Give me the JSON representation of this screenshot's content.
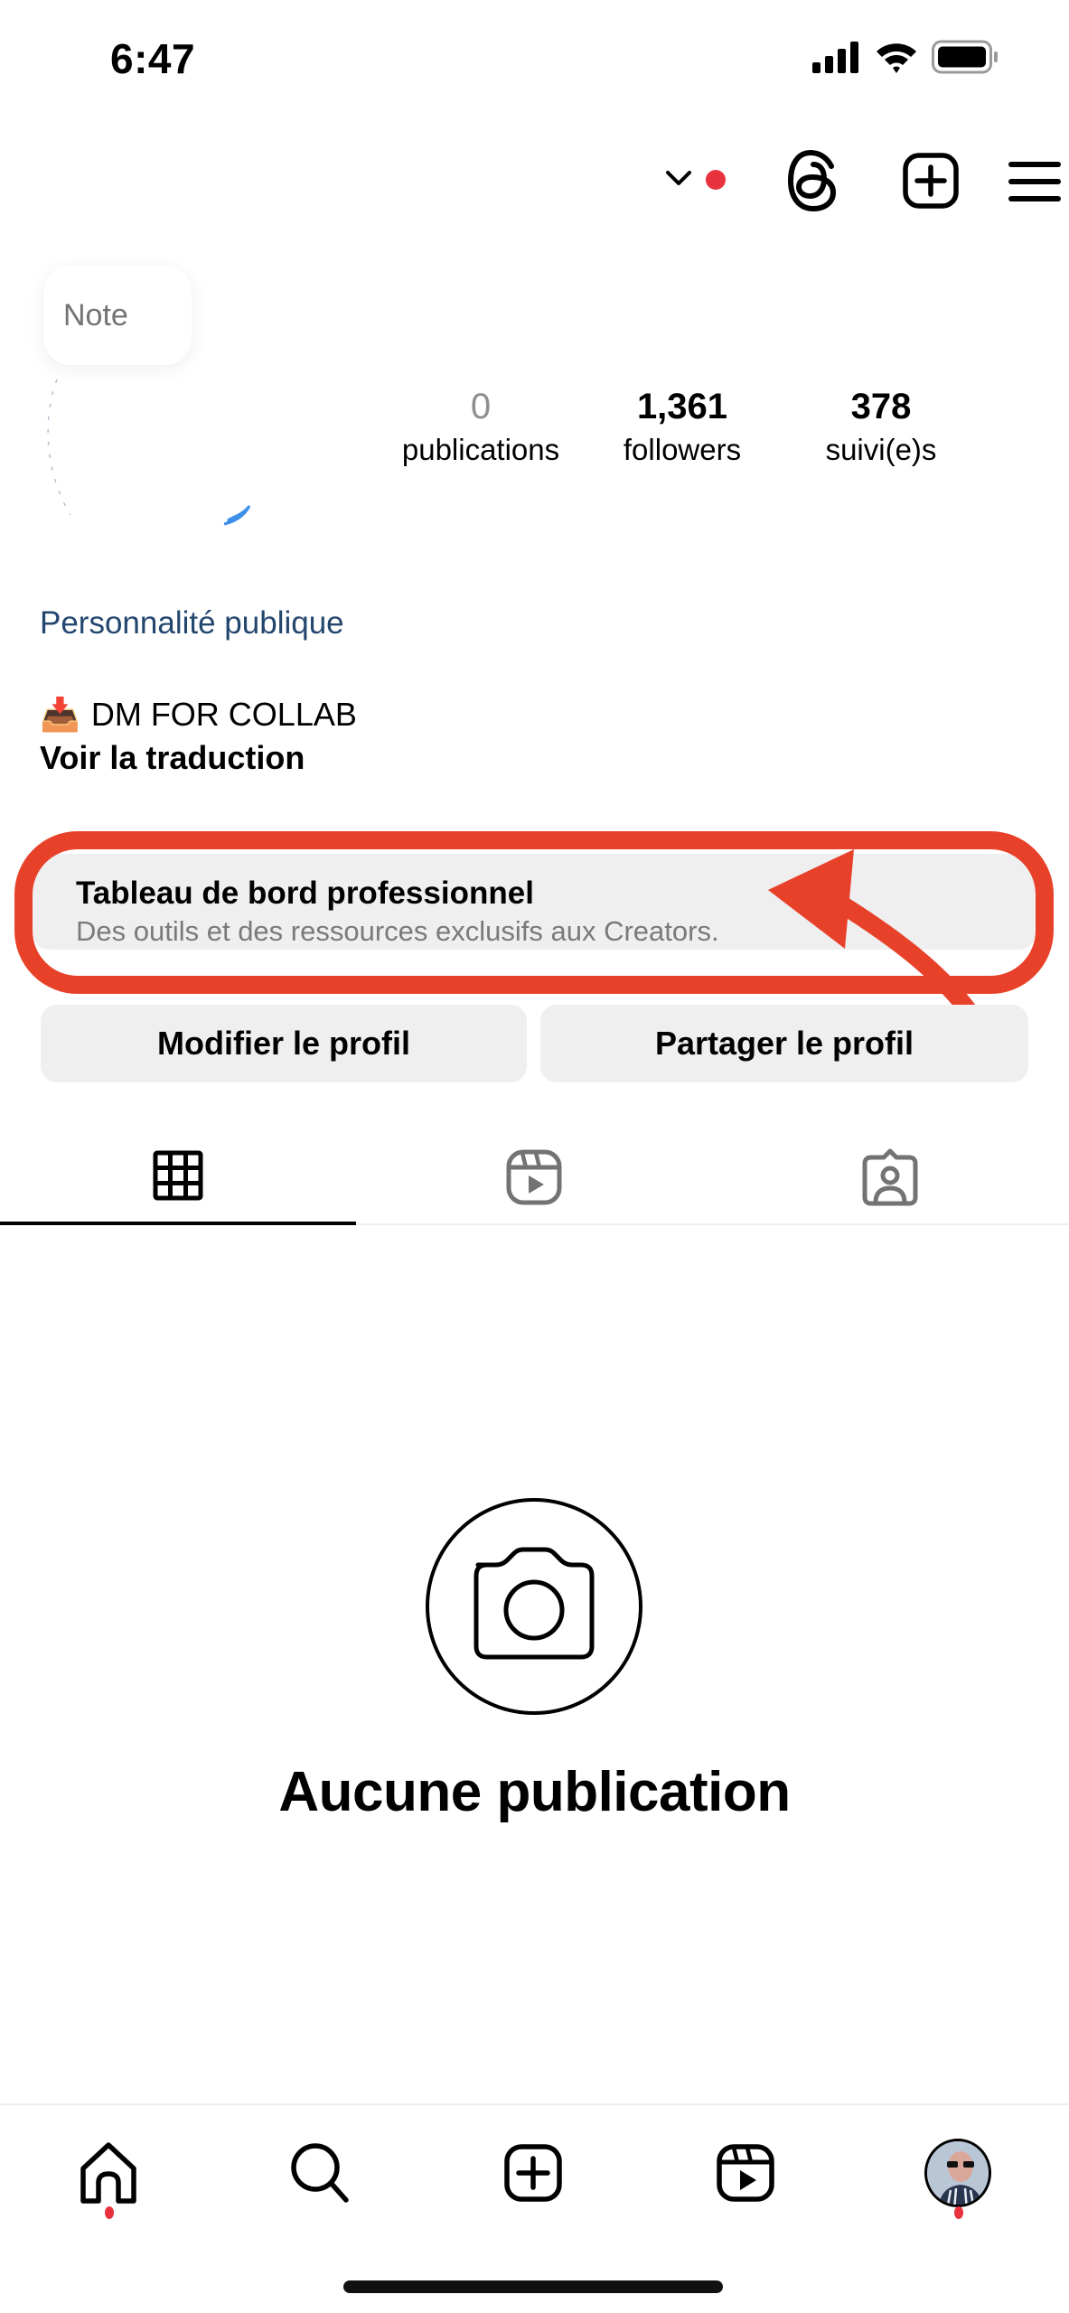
{
  "status_bar": {
    "time": "6:47",
    "icons": [
      "cellular-signal-icon",
      "wifi-icon",
      "battery-icon"
    ]
  },
  "header": {
    "icons": [
      "chevron-down-icon",
      "notification-dot",
      "threads-icon",
      "create-post-icon",
      "menu-icon"
    ],
    "accent_color": "#e8333f"
  },
  "profile": {
    "note_placeholder": "Note",
    "stats": [
      {
        "value": "0",
        "label": "publications"
      },
      {
        "value": "1,361",
        "label": "followers"
      },
      {
        "value": "378",
        "label": "suivi(e)s"
      }
    ],
    "category": "Personnalité publique",
    "bio_emoji": "📥",
    "bio": "DM FOR COLLAB",
    "translate_link": "Voir la traduction",
    "category_color": "#23466e"
  },
  "pro_dashboard": {
    "title": "Tableau de bord professionnel",
    "subtitle": "Des outils et des ressources exclusifs aux Creators.",
    "annotation_color": "#e8412a"
  },
  "buttons": {
    "edit_profile": "Modifier le profil",
    "share_profile": "Partager le profil"
  },
  "tabs": [
    {
      "name": "posts-grid",
      "icon": "grid-icon",
      "active": true
    },
    {
      "name": "reels",
      "icon": "reels-icon",
      "active": false
    },
    {
      "name": "tagged",
      "icon": "tagged-person-icon",
      "active": false
    }
  ],
  "empty_state": {
    "icon": "camera-icon",
    "title": "Aucune publication"
  },
  "bottom_nav": [
    {
      "name": "home",
      "icon": "home-icon",
      "has_badge": true
    },
    {
      "name": "search",
      "icon": "search-icon",
      "has_badge": false
    },
    {
      "name": "create",
      "icon": "create-icon",
      "has_badge": false
    },
    {
      "name": "reels",
      "icon": "reels-icon",
      "has_badge": false
    },
    {
      "name": "profile",
      "icon": "profile-avatar",
      "has_badge": true
    }
  ]
}
